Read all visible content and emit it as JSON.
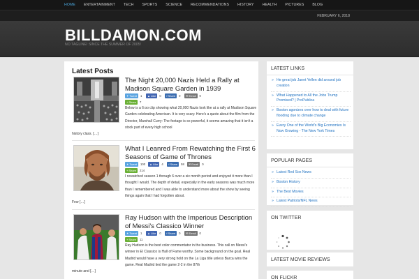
{
  "nav": {
    "items": [
      "Home",
      "Entertainment",
      "Tech",
      "Sports",
      "Science",
      "Recommendations",
      "History",
      "Health",
      "Pictures",
      "Blog"
    ],
    "date": "February 6, 2018"
  },
  "site": {
    "title": "BILLDAMON.COM",
    "tagline": "No tagline! Since the summer of 2005!"
  },
  "main": {
    "heading": "Latest Posts",
    "posts": [
      {
        "title": "The Night 20,000 Nazis Held a Rally at Madison Square Garden in 1939",
        "share": {
          "tweet": "Tweet",
          "tweet_count": "1",
          "like": "Like",
          "like_count": "0",
          "share": "Share",
          "share_count": "0",
          "email": "Email",
          "email_count": "0",
          "share2": "Share",
          "share2_count": "7"
        },
        "excerpt": "Below is a 6:oo clip showing what 20,000 Nazis look like at a rally at Madison Square Garden celebrating American. It is very scary. Here's a quote about the film from the Director, Marshall Curry: The footage is so powerful, it seems amazing that it isn't a stock part of every high school",
        "tail": "history class. […]"
      },
      {
        "title": "What I Leanred From Rewatching the First 6 Seasons of Game of Thrones",
        "share": {
          "tweet": "Tweet",
          "tweet_count": "100",
          "like": "Like",
          "like_count": "4",
          "share": "Share",
          "share_count": "58",
          "email": "Email",
          "email_count": "0",
          "share2": "Share",
          "share2_count": "214"
        },
        "excerpt": "I rewatched season 1 through 6 over a six month period and enjoyed it more than I thought I would. The depth of detail, especially in the early seasons was much more than I remembered and I was able to understand more about the show by seeing things again that I had forgotten about.",
        "tail": "Few […]"
      },
      {
        "title": "Ray Hudson with the Imperious Description of Messi's Classico Winner",
        "share": {
          "tweet": "Tweet",
          "tweet_count": "1",
          "like": "Like",
          "like_count": "0",
          "share": "Share",
          "share_count": "0",
          "email": "Email",
          "email_count": "0",
          "share2": "Share",
          "share2_count": "11"
        },
        "excerpt": "Ray Hudson is the best color commentator in the business. This call on Messi's winner in El Classico is Hall of Fame worthy. Some background on the goal. Real Madrid would have a very strong hold on the La Liga title unless Barca wins the game. Real Madrid tied the game 2-2 in the 87th",
        "tail": "minute and […]"
      }
    ]
  },
  "sidebar": {
    "latest_links": {
      "title": "Latest Links",
      "items": [
        "He great job Janet Yellen did around job creation",
        "What Happened to All the Jobs Trump Promised? | ProPublica",
        "Boston agonizes over how to deal with future flooding due to climate change",
        "Every One of the World's Big Economies Is Now Growing - The New York Times"
      ]
    },
    "popular_pages": {
      "title": "Popular Pages",
      "items": [
        "Latest Red Sox News",
        "Boston History",
        "The Best Movies",
        "Latest Patriots/NFL News"
      ]
    },
    "twitter": {
      "title": "On Twitter"
    },
    "movie_reviews": {
      "title": "Latest Movie Reviews"
    },
    "flickr": {
      "title": "On Flickr"
    }
  },
  "colors": {
    "accent": "#2273c2",
    "nav_active": "#4aa3d8",
    "header_bg": "#333333"
  }
}
